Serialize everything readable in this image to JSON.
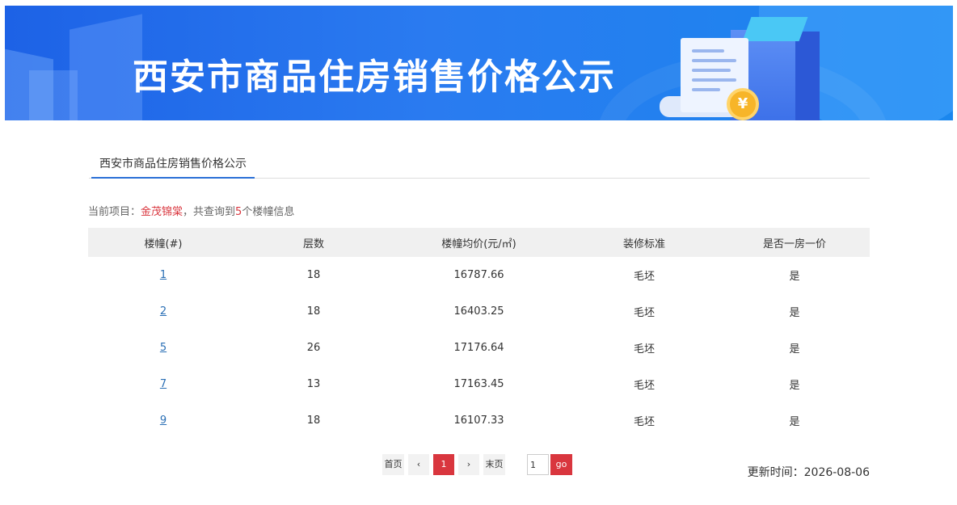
{
  "banner": {
    "title": "西安市商品住房销售价格公示",
    "coin_symbol": "¥"
  },
  "tabs": [
    {
      "label": "西安市商品住房销售价格公示"
    }
  ],
  "info": {
    "prefix": "当前项目：",
    "project": "金茂锦棠",
    "middle": "，共查询到",
    "count": "5",
    "suffix": "个楼幢信息"
  },
  "table": {
    "headers": [
      "楼幢(#)",
      "层数",
      "楼幢均价(元/㎡)",
      "装修标准",
      "是否一房一价"
    ],
    "rows": [
      [
        "1",
        "18",
        "16787.66",
        "毛坯",
        "是"
      ],
      [
        "2",
        "18",
        "16403.25",
        "毛坯",
        "是"
      ],
      [
        "5",
        "26",
        "17176.64",
        "毛坯",
        "是"
      ],
      [
        "7",
        "13",
        "17163.45",
        "毛坯",
        "是"
      ],
      [
        "9",
        "18",
        "16107.33",
        "毛坯",
        "是"
      ]
    ]
  },
  "pager": {
    "first": "首页",
    "prev": "‹",
    "current": "1",
    "next": "›",
    "last": "末页",
    "input_value": "1",
    "go": "go"
  },
  "updated": {
    "label": "更新时间：",
    "value": "2026-08-06"
  },
  "colors": {
    "accent": "#d9363e",
    "link": "#2a6fb5",
    "banner": "#1d62e6"
  }
}
